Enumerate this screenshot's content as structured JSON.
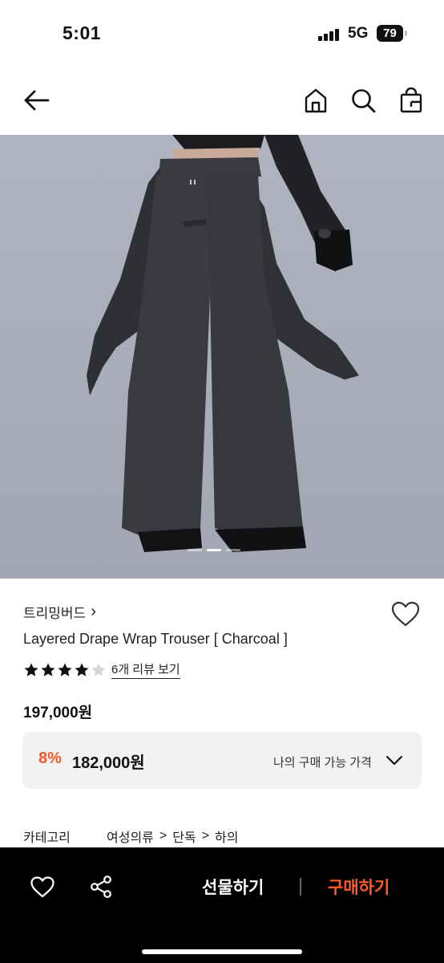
{
  "status_bar": {
    "time": "5:01",
    "network": "5G",
    "battery": "79"
  },
  "header": {
    "icons": [
      "back-arrow-icon",
      "home-icon",
      "search-icon",
      "shopping-bag-icon"
    ]
  },
  "product": {
    "image_description_icon": "product-photo",
    "image_pages": 3,
    "image_current_page": 2,
    "brand": "트리밍버드",
    "brand_chevron": "›",
    "name": "Layered Drape Wrap Trouser [ Charcoal ]",
    "rating": 4,
    "rating_max": 5,
    "review_link": "6개 리뷰 보기",
    "price": "197,000원"
  },
  "my_price": {
    "discount": "8%",
    "sale_price": "182,000원",
    "label": "나의 구매 가능 가격"
  },
  "category": {
    "label": "카테고리",
    "path": [
      "여성의류",
      "단독",
      "하의"
    ],
    "separator": ">"
  },
  "bottom_bar": {
    "gift_label": "선물하기",
    "buy_label": "구매하기"
  },
  "colors": {
    "accent_orange": "#f15a24",
    "buy_orange": "#ff5a1f",
    "panel_gray": "#f2f2f3"
  }
}
